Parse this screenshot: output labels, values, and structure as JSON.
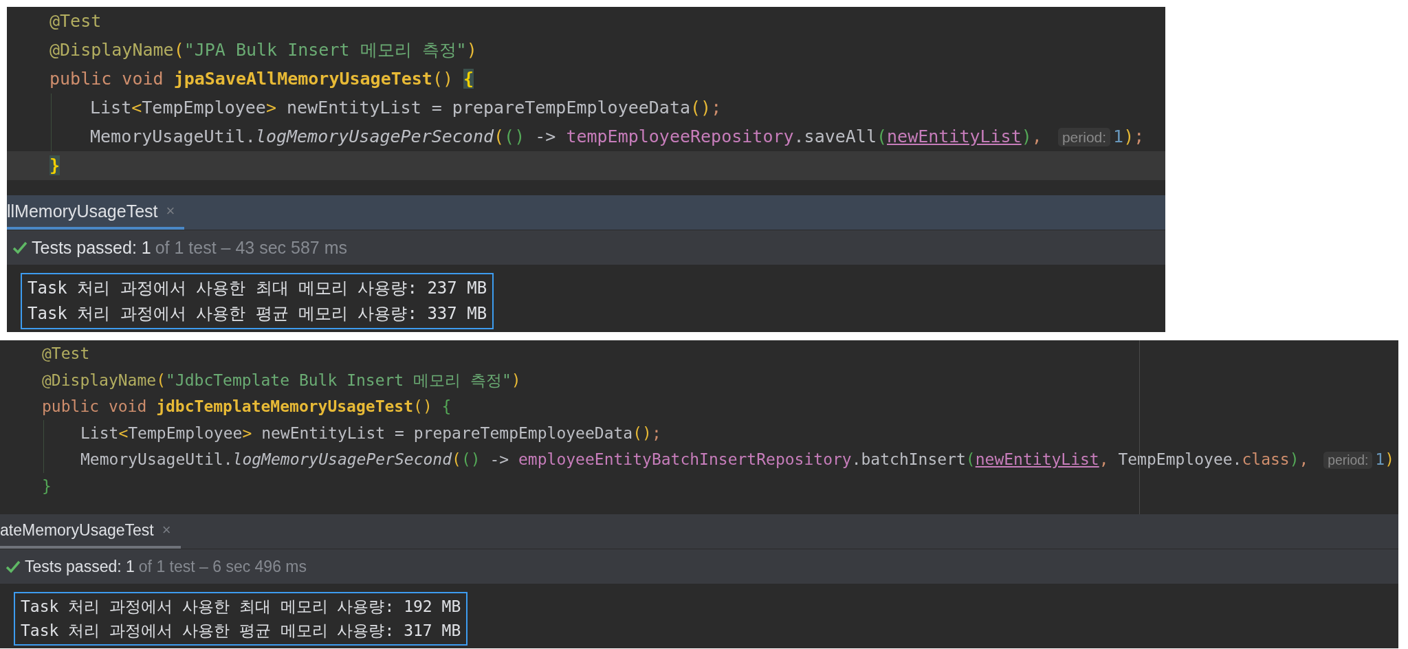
{
  "panels": [
    {
      "margin_guide": false,
      "editor": {
        "lines": [
          {
            "kind": "outer",
            "current": false,
            "tokens": [
              {
                "kind": "annotation",
                "text": "@Test"
              }
            ]
          },
          {
            "kind": "outer",
            "current": false,
            "tokens": [
              {
                "kind": "annotation",
                "text": "@DisplayName"
              },
              {
                "kind": "paren1",
                "text": "("
              },
              {
                "kind": "string",
                "text": "\"JPA Bulk Insert 메모리 측정\""
              },
              {
                "kind": "paren1",
                "text": ")"
              }
            ]
          },
          {
            "kind": "outer",
            "current": false,
            "tokens": [
              {
                "kind": "keyword",
                "text": "public void "
              },
              {
                "kind": "decl",
                "text": "jpaSaveAllMemoryUsageTest"
              },
              {
                "kind": "paren1",
                "text": "() "
              },
              {
                "kind": "brace-matched",
                "text": "{"
              }
            ]
          },
          {
            "kind": "inner",
            "current": false,
            "tokens": [
              {
                "kind": "plain",
                "text": "List"
              },
              {
                "kind": "paren1",
                "text": "<"
              },
              {
                "kind": "plain",
                "text": "TempEmployee"
              },
              {
                "kind": "paren1",
                "text": ">"
              },
              {
                "kind": "plain",
                "text": " newEntityList = prepareTempEmployeeData"
              },
              {
                "kind": "paren1",
                "text": "()"
              },
              {
                "kind": "punct",
                "text": ";"
              }
            ]
          },
          {
            "kind": "inner",
            "current": false,
            "tokens": [
              {
                "kind": "plain",
                "text": "MemoryUsageUtil."
              },
              {
                "kind": "static",
                "text": "logMemoryUsagePerSecond"
              },
              {
                "kind": "paren1",
                "text": "("
              },
              {
                "kind": "paren2",
                "text": "()"
              },
              {
                "kind": "plain",
                "text": " -> "
              },
              {
                "kind": "field",
                "text": "tempEmployeeRepository"
              },
              {
                "kind": "plain",
                "text": ".saveAll"
              },
              {
                "kind": "paren2",
                "text": "("
              },
              {
                "kind": "var",
                "text": "newEntityList"
              },
              {
                "kind": "paren2",
                "text": ")"
              },
              {
                "kind": "punct",
                "text": ", "
              },
              {
                "kind": "hint",
                "text": "period:"
              },
              {
                "kind": "number",
                "text": "1"
              },
              {
                "kind": "paren1",
                "text": ")"
              },
              {
                "kind": "punct",
                "text": ";"
              }
            ]
          },
          {
            "kind": "outer",
            "current": true,
            "tokens": [
              {
                "kind": "brace-matched",
                "text": "}"
              }
            ]
          }
        ]
      },
      "run_tab": {
        "label": "llMemoryUsageTest",
        "close": "×",
        "focused": true
      },
      "status": {
        "passed": "Tests passed: 1",
        "detail": "of 1 test – 43 sec 587 ms"
      },
      "console": {
        "lines": [
          "Task 처리 과정에서 사용한 최대 메모리 사용량: 237 MB",
          "Task 처리 과정에서 사용한 평균 메모리 사용량: 337 MB"
        ]
      }
    },
    {
      "margin_guide": true,
      "editor": {
        "lines": [
          {
            "kind": "outer",
            "current": false,
            "tokens": [
              {
                "kind": "annotation",
                "text": "@Test"
              }
            ]
          },
          {
            "kind": "outer",
            "current": false,
            "tokens": [
              {
                "kind": "annotation",
                "text": "@DisplayName"
              },
              {
                "kind": "paren1",
                "text": "("
              },
              {
                "kind": "string",
                "text": "\"JdbcTemplate Bulk Insert 메모리 측정\""
              },
              {
                "kind": "paren1",
                "text": ")"
              }
            ]
          },
          {
            "kind": "outer",
            "current": false,
            "tokens": [
              {
                "kind": "keyword",
                "text": "public void "
              },
              {
                "kind": "decl",
                "text": "jdbcTemplateMemoryUsageTest"
              },
              {
                "kind": "paren1",
                "text": "() "
              },
              {
                "kind": "paren2",
                "text": "{"
              }
            ]
          },
          {
            "kind": "inner",
            "current": false,
            "tokens": [
              {
                "kind": "plain",
                "text": "List"
              },
              {
                "kind": "paren1",
                "text": "<"
              },
              {
                "kind": "plain",
                "text": "TempEmployee"
              },
              {
                "kind": "paren1",
                "text": ">"
              },
              {
                "kind": "plain",
                "text": " newEntityList = prepareTempEmployeeData"
              },
              {
                "kind": "paren1",
                "text": "()"
              },
              {
                "kind": "punct",
                "text": ";"
              }
            ]
          },
          {
            "kind": "inner",
            "current": false,
            "tokens": [
              {
                "kind": "plain",
                "text": "MemoryUsageUtil."
              },
              {
                "kind": "static",
                "text": "logMemoryUsagePerSecond"
              },
              {
                "kind": "paren1",
                "text": "("
              },
              {
                "kind": "paren2",
                "text": "()"
              },
              {
                "kind": "plain",
                "text": " -> "
              },
              {
                "kind": "field",
                "text": "employeeEntityBatchInsertRepository"
              },
              {
                "kind": "plain",
                "text": ".batchInsert"
              },
              {
                "kind": "paren2",
                "text": "("
              },
              {
                "kind": "var",
                "text": "newEntityList"
              },
              {
                "kind": "punct",
                "text": ", "
              },
              {
                "kind": "plain",
                "text": "TempEmployee."
              },
              {
                "kind": "keyword",
                "text": "class"
              },
              {
                "kind": "paren2",
                "text": ")"
              },
              {
                "kind": "punct",
                "text": ", "
              },
              {
                "kind": "hint",
                "text": "period:"
              },
              {
                "kind": "number",
                "text": "1"
              },
              {
                "kind": "paren1",
                "text": ")"
              }
            ]
          },
          {
            "kind": "outer",
            "current": false,
            "tokens": [
              {
                "kind": "paren2",
                "text": "}"
              }
            ]
          }
        ]
      },
      "run_tab": {
        "label": "ateMemoryUsageTest",
        "close": "×",
        "focused": false
      },
      "status": {
        "passed": "Tests passed: 1",
        "detail": "of 1 test – 6 sec 496 ms"
      },
      "console": {
        "lines": [
          "Task 처리 과정에서 사용한 최대 메모리 사용량: 192 MB",
          "Task 처리 과정에서 사용한 평균 메모리 사용량: 317 MB"
        ]
      }
    }
  ]
}
